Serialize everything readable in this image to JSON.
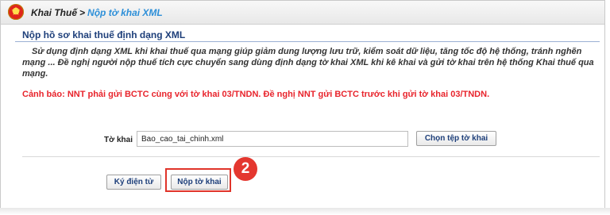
{
  "breadcrumb": {
    "root": "Khai Thuế",
    "separator": ">",
    "current": "Nộp tờ khai XML"
  },
  "section": {
    "title": "Nộp hồ sơ khai thuế định dạng XML"
  },
  "intro_text": "Sử dụng định dạng XML khi khai thuế qua mạng giúp giảm dung lượng lưu trữ, kiểm soát dữ liệu, tăng tốc độ hệ thống, tránh nghẽn mạng ... Đề nghị người nộp thuế tích cực chuyển sang dùng định dạng tờ khai XML khi kê khai và gửi tờ khai trên hệ thống Khai thuế qua mạng.",
  "warning_text": "Cảnh báo: NNT phải gửi BCTC cùng với tờ khai 03/TNDN. Đề nghị NNT gửi BCTC trước khi gửi tờ khai 03/TNDN.",
  "file": {
    "label": "Tờ khai",
    "value": "Bao_cao_tai_chinh.xml",
    "choose_button": "Chọn tệp tờ khai"
  },
  "actions": {
    "sign_button": "Ký điện tử",
    "submit_button": "Nộp tờ khai"
  },
  "step_badge": "2",
  "colors": {
    "breadcrumb_link": "#2d8fd8",
    "section_title": "#1e3f7a",
    "warning": "#e8242c",
    "highlight": "#e0342a"
  }
}
